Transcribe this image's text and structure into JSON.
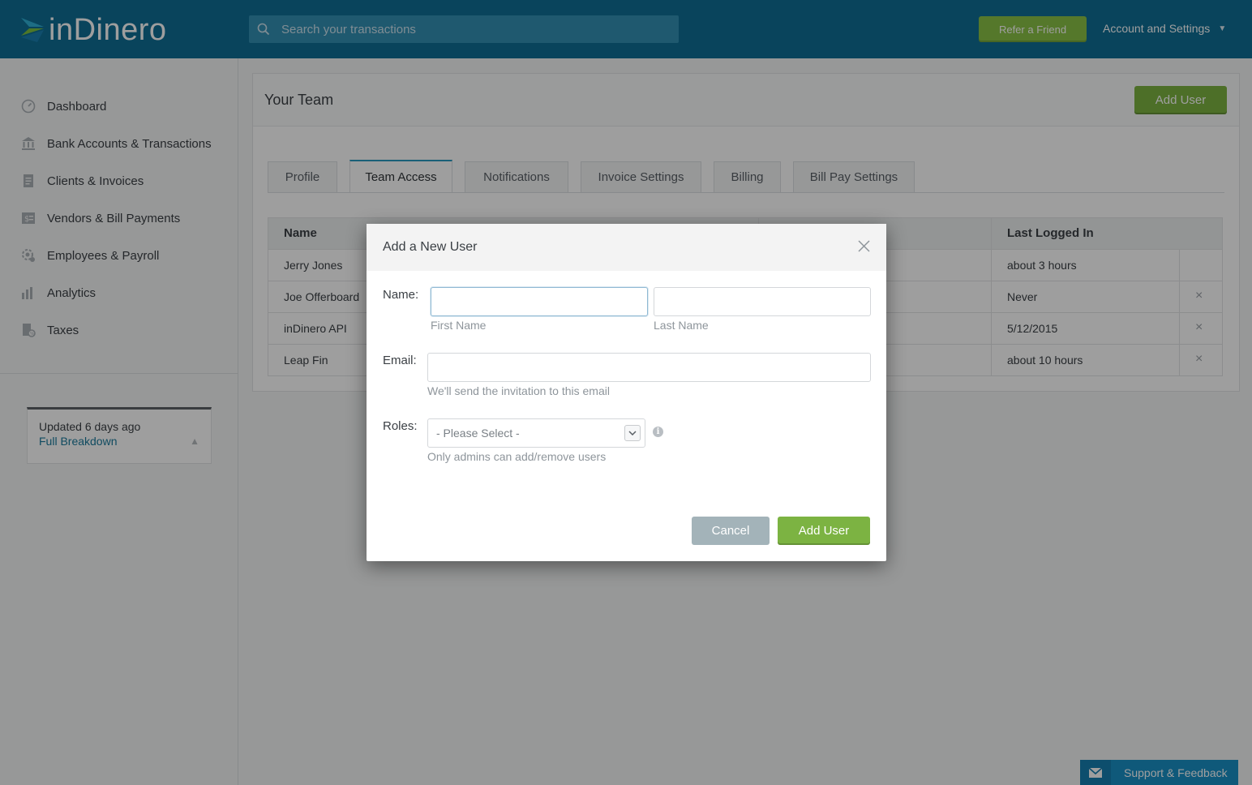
{
  "brand": {
    "name": "inDinero"
  },
  "topbar": {
    "search_placeholder": "Search your transactions",
    "refer_label": "Refer a Friend",
    "account_label": "Account and Settings",
    "account_caret": "▼"
  },
  "sidebar": {
    "items": [
      {
        "label": "Dashboard",
        "icon": "dashboard-icon"
      },
      {
        "label": "Bank Accounts & Transactions",
        "icon": "bank-icon"
      },
      {
        "label": "Clients & Invoices",
        "icon": "invoice-icon"
      },
      {
        "label": "Vendors & Bill Payments",
        "icon": "bill-icon"
      },
      {
        "label": "Employees & Payroll",
        "icon": "payroll-icon"
      },
      {
        "label": "Analytics",
        "icon": "analytics-icon"
      },
      {
        "label": "Taxes",
        "icon": "taxes-icon"
      }
    ],
    "status": {
      "updated": "Updated 6 days ago",
      "link": "Full Breakdown"
    }
  },
  "main": {
    "title": "Your Team",
    "add_user_label": "Add User",
    "tabs": [
      {
        "label": "Profile"
      },
      {
        "label": "Team Access"
      },
      {
        "label": "Notifications"
      },
      {
        "label": "Invoice Settings"
      },
      {
        "label": "Billing"
      },
      {
        "label": "Bill Pay Settings"
      }
    ],
    "table": {
      "columns": {
        "name": "Name",
        "last_logged_in": "Last Logged In"
      },
      "rows": [
        {
          "name": "Jerry Jones",
          "last": "about 3 hours",
          "removable": false
        },
        {
          "name": "Joe Offerboard",
          "last": "Never",
          "removable": true
        },
        {
          "name": "inDinero API",
          "last": "5/12/2015",
          "removable": true
        },
        {
          "name": "Leap Fin",
          "last": "about 10 hours",
          "removable": true
        }
      ],
      "remove_glyph": "×"
    }
  },
  "modal": {
    "title": "Add a New User",
    "name_label": "Name:",
    "first_name_value": "",
    "last_name_value": "",
    "first_name_hint": "First Name",
    "last_name_hint": "Last Name",
    "email_label": "Email:",
    "email_value": "",
    "email_hint": "We'll send the invitation to this email",
    "roles_label": "Roles:",
    "roles_selected": "- Please Select -",
    "roles_hint": "Only admins can add/remove users",
    "info_glyph": "i",
    "cancel_label": "Cancel",
    "add_label": "Add User"
  },
  "support": {
    "label": "Support & Feedback"
  },
  "colors": {
    "topbar": "#0f6f95",
    "accent_green": "#7cb342",
    "link_blue": "#1a7a9c",
    "support_blue": "#1990c6"
  }
}
